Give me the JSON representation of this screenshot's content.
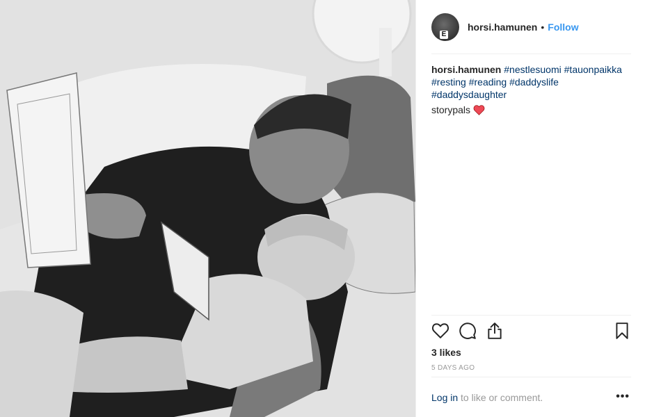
{
  "photo": {
    "alt_icon": "photo"
  },
  "header": {
    "avatar_badge": "E",
    "username": "horsi.hamunen",
    "separator": "•",
    "follow_label": "Follow"
  },
  "caption": {
    "username": "horsi.hamunen",
    "hashtags": [
      "#nestlesuomi",
      "#tauonpaikka",
      "#resting",
      "#reading",
      "#daddyslife",
      "#daddysdaughter"
    ]
  },
  "comment": {
    "text": "storypals",
    "emoji_icon": "red-heart-icon"
  },
  "actions": {
    "like_icon": "heart-outline-icon",
    "comment_icon": "comment-bubble-icon",
    "share_icon": "share-upload-icon",
    "save_icon": "bookmark-icon"
  },
  "likes": "3 likes",
  "timestamp": "5 DAYS AGO",
  "login": {
    "link": "Log in",
    "rest": " to like or comment."
  },
  "more_label": "•••",
  "colors": {
    "link_blue": "#3897f0",
    "hashtag": "#003569",
    "muted": "#999999",
    "heart": "#ed4956"
  }
}
